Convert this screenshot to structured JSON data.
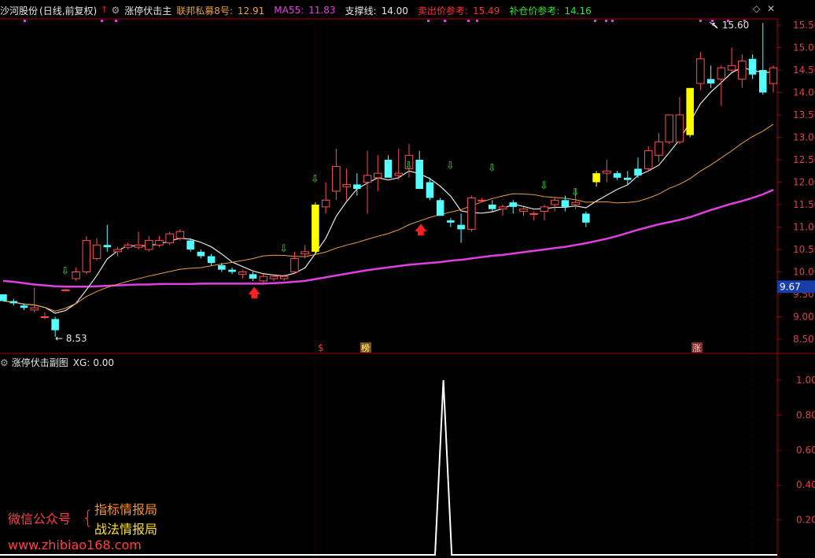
{
  "header": {
    "stock": "沙河股份",
    "mode": "(日线,前复权)",
    "indicator": "涨停伏击主",
    "lines": [
      {
        "label": "联邦私募8号:",
        "value": "12.91",
        "color": "#e8a040"
      },
      {
        "label": "MA55:",
        "value": "11.83",
        "color": "#e040e0"
      },
      {
        "label": "支撑线:",
        "value": "14.00",
        "color": "#e6e6e6"
      },
      {
        "label": "卖出价参考:",
        "value": "15.49",
        "color": "#ff3030"
      },
      {
        "label": "补仓价参考:",
        "value": "14.16",
        "color": "#30e030"
      }
    ]
  },
  "sub_header": {
    "indicator": "涨停伏击副图",
    "xg_label": "XG:",
    "xg_value": "0.00"
  },
  "main_axis": {
    "ticks": [
      "15.50",
      "15.00",
      "14.50",
      "14.00",
      "13.50",
      "13.00",
      "12.50",
      "12.00",
      "11.50",
      "11.00",
      "10.50",
      "10.00",
      "9.50",
      "9.00",
      "8.50"
    ],
    "current_price": "9.67"
  },
  "sub_axis": {
    "ticks": [
      "1.00",
      "0.80",
      "0.60",
      "0.40",
      "0.20"
    ]
  },
  "annotations": {
    "high": "15.60",
    "low": "8.53",
    "marker_s": "$",
    "marker_bang": "榜",
    "marker_zhang": "涨"
  },
  "watermark": {
    "wechat": "微信公众号",
    "line1": "指标情报局",
    "line2": "战法情报局",
    "url": "www.zhibiao168.com"
  },
  "colors": {
    "up": "#ff5050",
    "down": "#54ffff",
    "limit_up": "#ffff00",
    "ma_white": "#e6e6e6",
    "ma_orange": "#e8a040",
    "ma55": "#e040e0",
    "axis_red": "#a00000"
  },
  "chart_data": [
    {
      "type": "candlestick",
      "title": "沙河股份 (日线,前复权)",
      "ylim": [
        8.3,
        15.7
      ],
      "candles": [
        [
          9.5,
          9.5,
          9.4,
          9.35
        ],
        [
          9.35,
          9.4,
          9.25,
          9.3
        ],
        [
          9.25,
          9.3,
          9.15,
          9.2
        ],
        [
          9.15,
          9.65,
          9.1,
          9.2
        ],
        [
          9.0,
          9.1,
          8.95,
          9.0
        ],
        [
          8.95,
          9.0,
          8.55,
          8.7
        ],
        [
          9.6,
          9.62,
          9.58,
          9.6
        ],
        [
          9.85,
          10.1,
          9.8,
          10.0
        ],
        [
          10.0,
          10.8,
          9.95,
          10.7
        ],
        [
          10.3,
          10.75,
          10.25,
          10.6
        ],
        [
          10.6,
          11.05,
          10.45,
          10.55
        ],
        [
          10.45,
          10.55,
          10.35,
          10.5
        ],
        [
          10.55,
          10.65,
          10.5,
          10.6
        ],
        [
          10.55,
          10.9,
          10.5,
          10.6
        ],
        [
          10.5,
          10.8,
          10.45,
          10.7
        ],
        [
          10.6,
          10.8,
          10.55,
          10.7
        ],
        [
          10.65,
          10.9,
          10.6,
          10.85
        ],
        [
          10.75,
          10.95,
          10.7,
          10.9
        ],
        [
          10.7,
          10.75,
          10.45,
          10.5
        ],
        [
          10.45,
          10.5,
          10.3,
          10.35
        ],
        [
          10.35,
          10.4,
          10.15,
          10.2
        ],
        [
          10.15,
          10.2,
          10.0,
          10.05
        ],
        [
          10.05,
          10.1,
          9.95,
          10.0
        ],
        [
          9.95,
          10.05,
          9.85,
          10.0
        ],
        [
          9.95,
          10.0,
          9.8,
          9.85
        ],
        [
          9.8,
          9.95,
          9.75,
          9.9
        ],
        [
          9.85,
          9.95,
          9.8,
          9.9
        ],
        [
          9.85,
          9.95,
          9.8,
          9.9
        ],
        [
          10.0,
          10.45,
          9.95,
          10.3
        ],
        [
          10.4,
          10.6,
          10.3,
          10.45
        ],
        [
          10.45,
          11.55,
          10.4,
          11.5
        ],
        [
          11.45,
          12.0,
          11.3,
          11.6
        ],
        [
          11.8,
          12.75,
          11.6,
          12.35
        ],
        [
          11.9,
          12.3,
          11.6,
          11.95
        ],
        [
          11.95,
          12.2,
          11.7,
          11.85
        ],
        [
          12.0,
          12.7,
          11.3,
          12.15
        ],
        [
          12.1,
          12.6,
          11.8,
          12.2
        ],
        [
          12.5,
          12.6,
          12.15,
          12.1
        ],
        [
          12.15,
          12.75,
          12.05,
          12.2
        ],
        [
          12.3,
          12.85,
          12.1,
          12.6
        ],
        [
          12.5,
          12.7,
          11.85,
          11.85
        ],
        [
          12.0,
          12.1,
          11.6,
          11.65
        ],
        [
          11.6,
          11.65,
          11.3,
          11.25
        ],
        [
          11.15,
          11.2,
          11.0,
          11.1
        ],
        [
          11.05,
          11.3,
          10.65,
          10.95
        ],
        [
          10.95,
          11.7,
          10.9,
          11.65
        ],
        [
          11.6,
          11.65,
          11.55,
          11.6
        ],
        [
          11.5,
          11.6,
          11.35,
          11.4
        ],
        [
          11.4,
          11.5,
          11.25,
          11.45
        ],
        [
          11.55,
          11.6,
          11.3,
          11.45
        ],
        [
          11.35,
          11.45,
          11.25,
          11.4
        ],
        [
          11.3,
          11.35,
          11.15,
          11.3
        ],
        [
          11.35,
          11.5,
          11.15,
          11.45
        ],
        [
          11.5,
          11.65,
          11.35,
          11.6
        ],
        [
          11.6,
          11.7,
          11.35,
          11.45
        ],
        [
          11.5,
          11.85,
          11.4,
          11.55
        ],
        [
          11.3,
          11.35,
          11.0,
          11.1
        ],
        [
          12.0,
          12.25,
          11.9,
          12.2
        ],
        [
          12.2,
          12.5,
          12.0,
          12.25
        ],
        [
          12.2,
          12.25,
          12.05,
          12.1
        ],
        [
          12.1,
          12.25,
          11.95,
          12.05
        ],
        [
          12.3,
          12.55,
          12.1,
          12.15
        ],
        [
          12.3,
          12.8,
          12.25,
          12.7
        ],
        [
          12.6,
          13.1,
          12.45,
          12.9
        ],
        [
          12.9,
          13.45,
          12.85,
          13.5
        ],
        [
          12.9,
          13.9,
          12.85,
          13.5
        ],
        [
          13.05,
          14.1,
          13.0,
          14.1
        ],
        [
          14.2,
          14.9,
          14.05,
          14.75
        ],
        [
          14.3,
          14.6,
          14.1,
          14.2
        ],
        [
          14.3,
          14.6,
          13.7,
          14.55
        ],
        [
          14.5,
          15.0,
          14.45,
          14.6
        ],
        [
          14.3,
          14.85,
          14.1,
          14.7
        ],
        [
          14.75,
          14.85,
          14.3,
          14.4
        ],
        [
          14.5,
          15.55,
          13.95,
          14.0
        ],
        [
          14.2,
          14.6,
          14.0,
          14.55
        ]
      ],
      "series": [
        {
          "name": "MA55",
          "values": [
            9.8,
            9.78,
            9.75,
            9.72,
            9.7,
            9.68,
            9.67,
            9.67,
            9.67,
            9.68,
            9.69,
            9.7,
            9.71,
            9.72,
            9.72,
            9.73,
            9.73,
            9.73,
            9.73,
            9.74,
            9.74,
            9.74,
            9.74,
            9.74,
            9.74,
            9.74,
            9.75,
            9.76,
            9.78,
            9.8,
            9.84,
            9.88,
            9.92,
            9.96,
            10.0,
            10.04,
            10.07,
            10.1,
            10.13,
            10.16,
            10.18,
            10.2,
            10.22,
            10.25,
            10.27,
            10.3,
            10.33,
            10.36,
            10.38,
            10.41,
            10.44,
            10.47,
            10.5,
            10.53,
            10.56,
            10.6,
            10.64,
            10.69,
            10.74,
            10.8,
            10.87,
            10.94,
            11.0,
            11.06,
            11.11,
            11.16,
            11.22,
            11.3,
            11.38,
            11.45,
            11.52,
            11.58,
            11.65,
            11.73,
            11.83
          ]
        }
      ]
    },
    {
      "type": "line",
      "title": "涨停伏击副图",
      "ylim": [
        0,
        1.05
      ],
      "series": [
        {
          "name": "XG",
          "values": [
            0,
            0,
            0,
            0,
            0,
            0,
            0,
            0,
            0,
            0,
            0,
            0,
            0,
            0,
            0,
            0,
            0,
            0,
            0,
            0,
            0,
            0,
            0,
            0,
            0,
            0,
            0,
            0,
            0,
            0,
            0,
            0,
            0,
            0,
            0,
            0,
            0,
            0,
            0,
            0,
            0,
            0,
            0,
            0,
            0,
            0,
            0,
            0,
            0,
            0,
            0,
            0,
            0,
            0,
            0,
            0,
            0,
            0,
            0,
            0,
            0,
            0,
            0,
            0,
            0,
            0,
            0,
            0,
            0,
            0,
            0,
            0,
            0,
            0,
            0
          ]
        },
        {
          "name": "XG-pulse",
          "values": [
            [
              41.5,
              0
            ],
            [
              42.3,
              1.0
            ],
            [
              43.1,
              0
            ]
          ]
        }
      ]
    }
  ]
}
